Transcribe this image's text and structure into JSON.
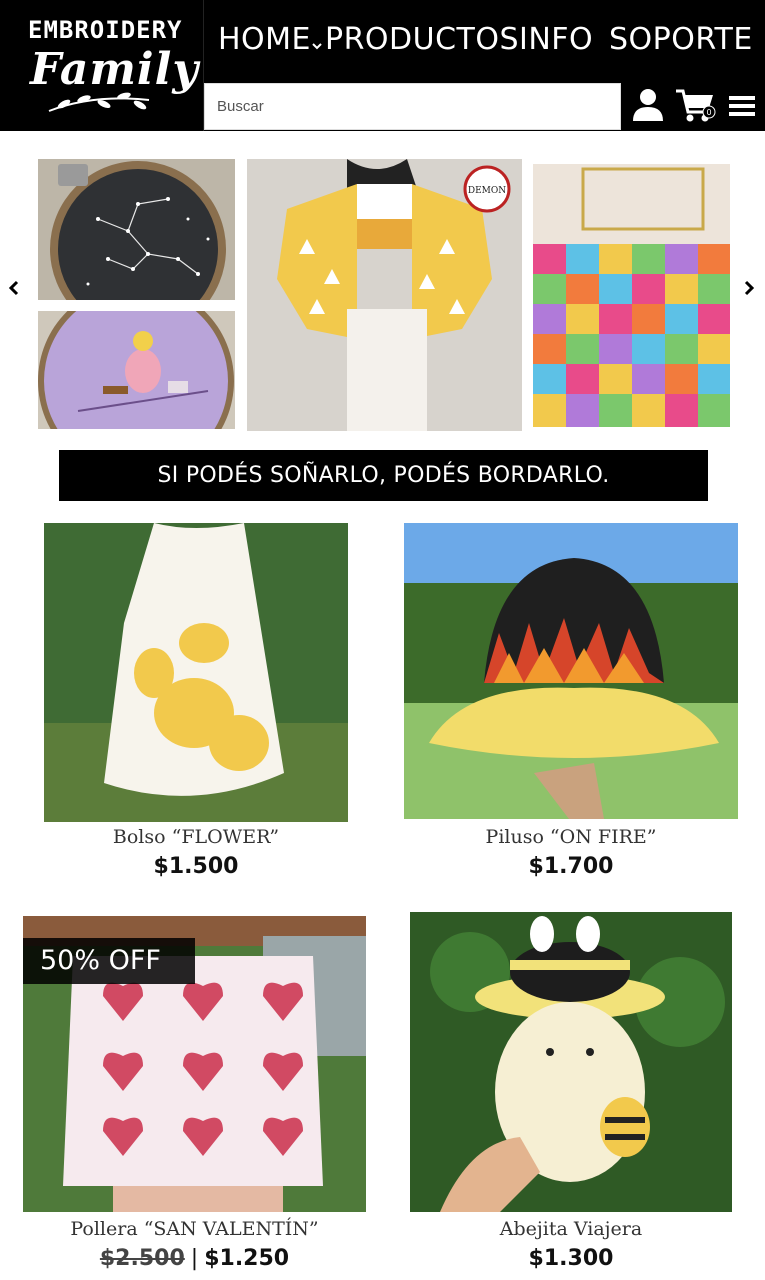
{
  "logo": {
    "top_text": "EMBROIDERY",
    "script_text": "Family"
  },
  "nav": {
    "items": [
      {
        "label": "HOME"
      },
      {
        "label": "PRODUCTOS"
      },
      {
        "label": "INFO"
      },
      {
        "label": "SOPORTE"
      }
    ]
  },
  "search": {
    "placeholder": "Buscar"
  },
  "cart": {
    "count": "0"
  },
  "slogan": "SI PODÉS SOÑARLO, PODÉS BORDARLO.",
  "products": [
    {
      "name": "Bolso “FLOWER”",
      "price": "$1.500"
    },
    {
      "name": "Piluso “ON FIRE”",
      "price": "$1.700"
    },
    {
      "name": "Pollera “SAN VALENTÍN”",
      "old_price": "$2.500",
      "price": "$1.250",
      "badge": "50% OFF"
    },
    {
      "name": "Abejita Viajera",
      "price": "$1.300"
    }
  ],
  "colors": {
    "header_bg": "#000000",
    "accent_yellow": "#f2c94c",
    "text": "#111111"
  },
  "icons": [
    "user-icon",
    "cart-icon",
    "menu-icon",
    "chevron-left-icon",
    "chevron-right-icon",
    "chevron-down-icon"
  ]
}
